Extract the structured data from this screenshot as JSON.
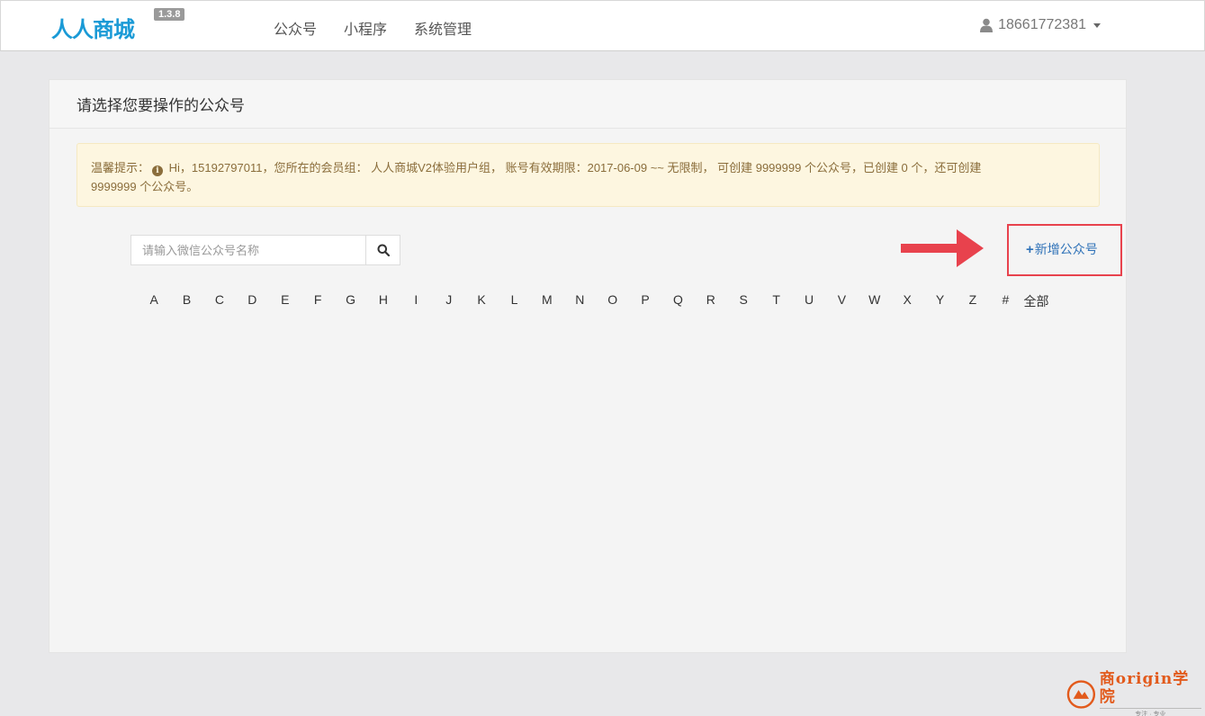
{
  "header": {
    "logo_text": "人人商城",
    "version": "1.3.8",
    "nav": [
      "公众号",
      "小程序",
      "系统管理"
    ],
    "user": "18661772381"
  },
  "panel": {
    "title": "请选择您要操作的公众号",
    "notice_label": "温馨提示：",
    "notice_line1": " Hi，15192797011，您所在的会员组： 人人商城V2体验用户组， 账号有效期限：2017-06-09 ~~ 无限制， 可创建 9999999 个公众号，已创建 0 个，还可创建",
    "notice_line2": "9999999 个公众号。",
    "search_placeholder": "请输入微信公众号名称",
    "add_label": "新增公众号",
    "letters": [
      "A",
      "B",
      "C",
      "D",
      "E",
      "F",
      "G",
      "H",
      "I",
      "J",
      "K",
      "L",
      "M",
      "N",
      "O",
      "P",
      "Q",
      "R",
      "S",
      "T",
      "U",
      "V",
      "W",
      "X",
      "Y",
      "Z",
      "#"
    ],
    "all_label": "全部"
  },
  "watermark": {
    "title": "商origin学院",
    "subtitle": "专注 · 专业"
  },
  "colors": {
    "accent": "#1a9ad6",
    "highlight": "#e8424d",
    "link": "#2f72b8",
    "notice_bg": "#fdf6e0"
  }
}
